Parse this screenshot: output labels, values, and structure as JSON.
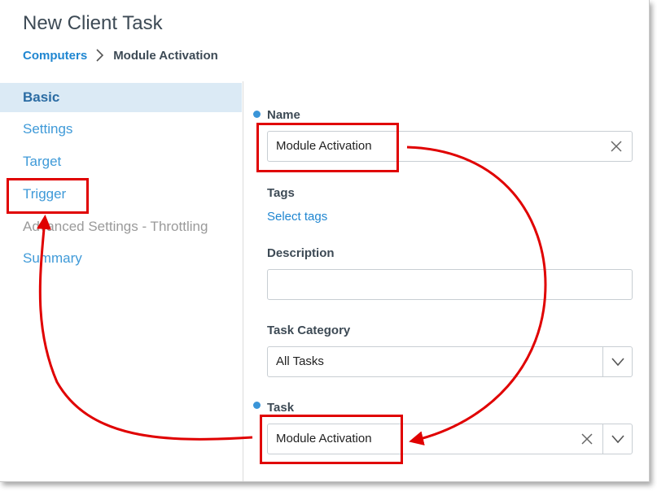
{
  "header": {
    "title": "New Client Task",
    "breadcrumb": {
      "link": "Computers",
      "current": "Module Activation"
    }
  },
  "sidebar": {
    "items": [
      {
        "label": "Basic",
        "state": "active"
      },
      {
        "label": "Settings",
        "state": "normal"
      },
      {
        "label": "Target",
        "state": "normal"
      },
      {
        "label": "Trigger",
        "state": "normal"
      },
      {
        "label": "Advanced Settings - Throttling",
        "state": "disabled"
      },
      {
        "label": "Summary",
        "state": "normal"
      }
    ]
  },
  "form": {
    "name": {
      "label": "Name",
      "value": "Module Activation",
      "required": true
    },
    "tags": {
      "label": "Tags",
      "link": "Select tags"
    },
    "description": {
      "label": "Description",
      "value": ""
    },
    "task_category": {
      "label": "Task Category",
      "value": "All Tasks"
    },
    "task": {
      "label": "Task",
      "value": "Module Activation",
      "required": true
    }
  },
  "icons": {
    "breadcrumb_separator": "chevron-right-icon",
    "clear": "close-icon",
    "dropdown": "chevron-down-icon"
  },
  "colors": {
    "accent": "#1f86d1",
    "active_bg": "#dbeaf5",
    "annotation": "#e00000",
    "required_dot": "#3a95d8"
  }
}
